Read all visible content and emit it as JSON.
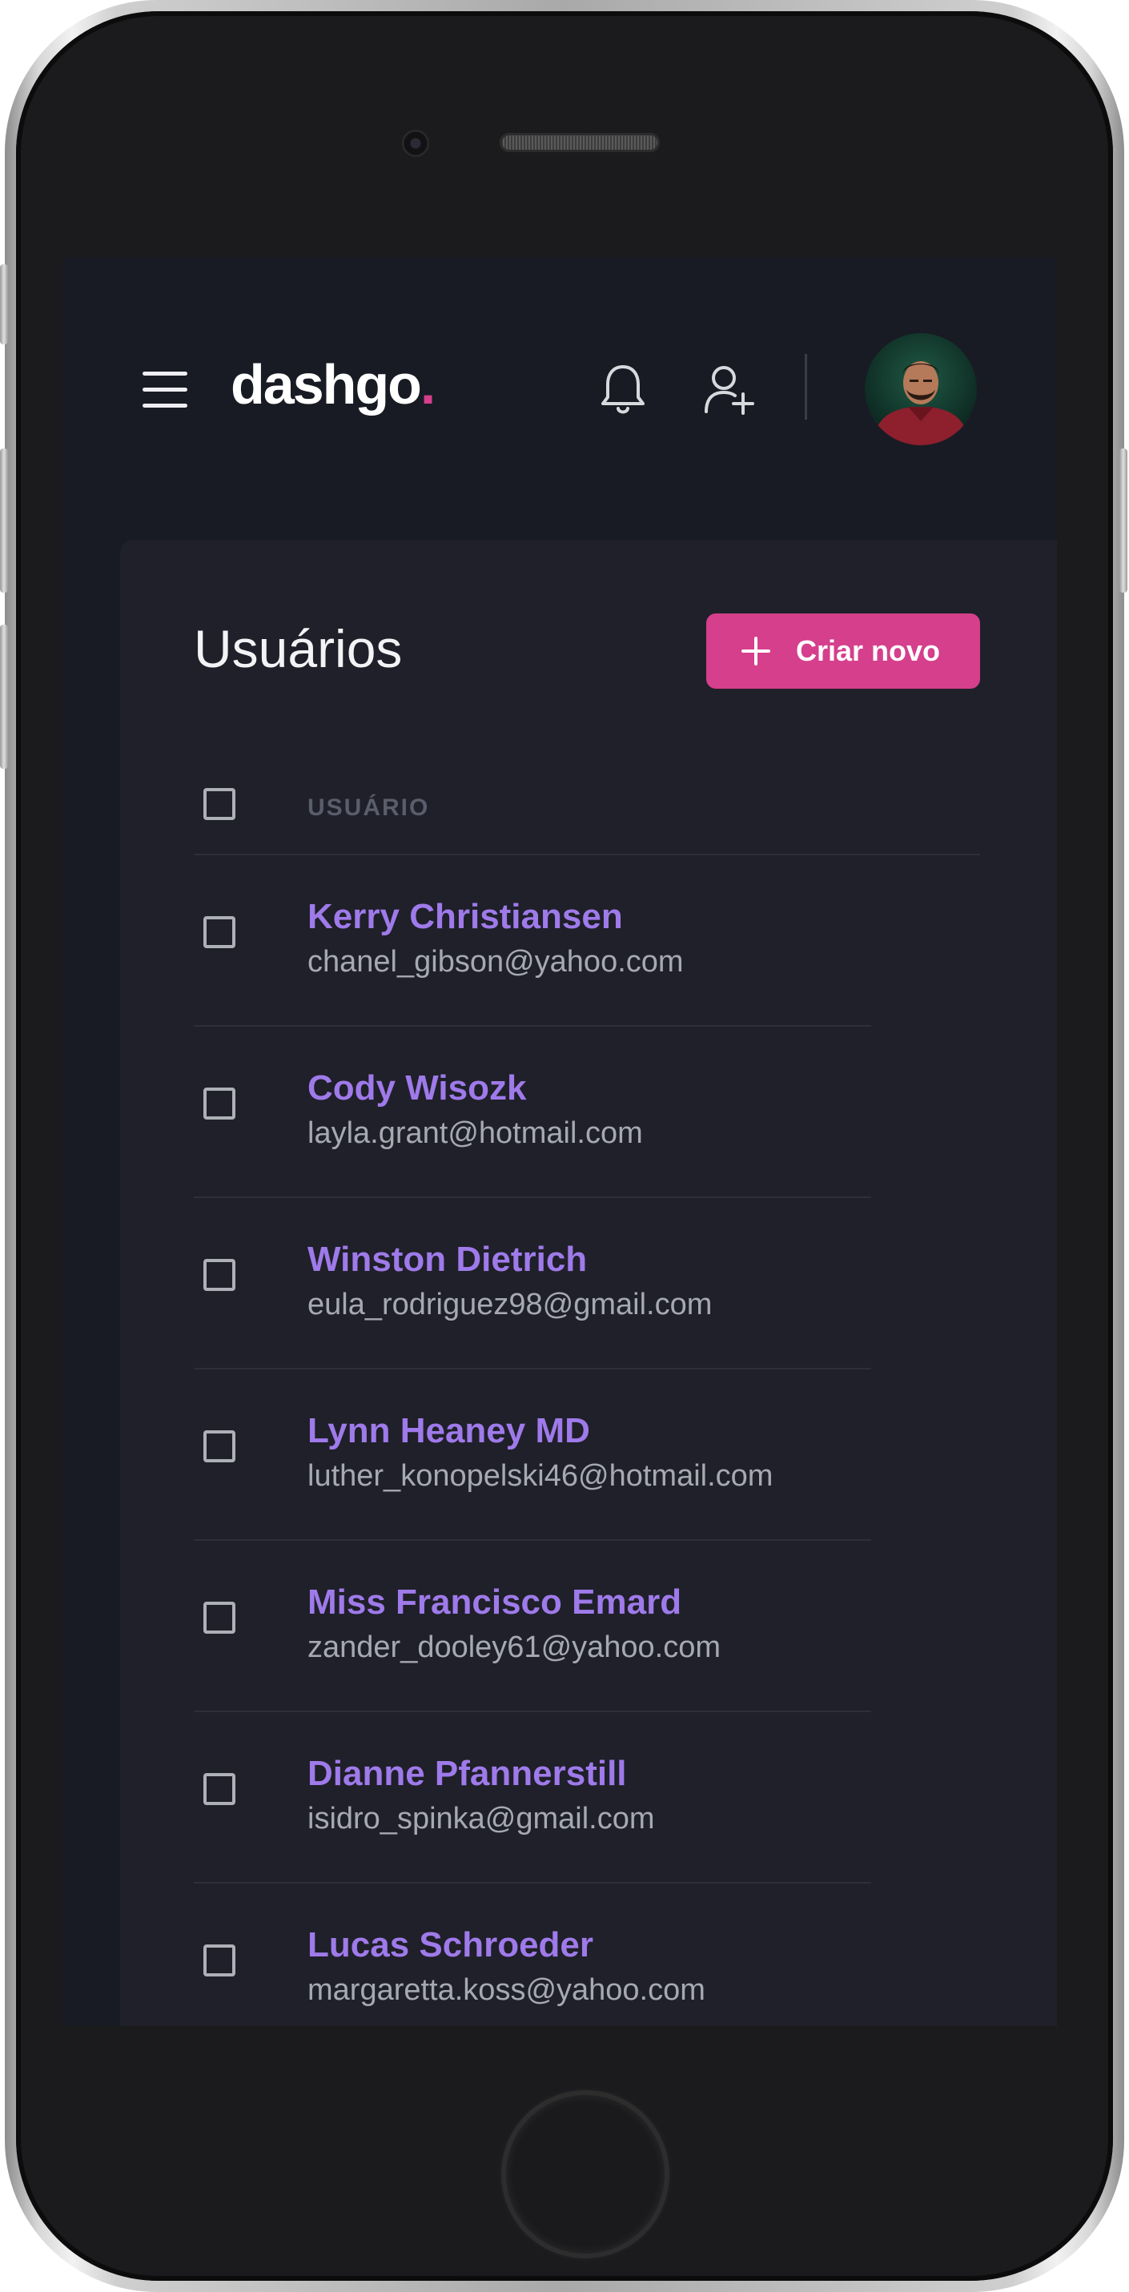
{
  "header": {
    "brand": "dashgo",
    "brand_dot": "."
  },
  "page": {
    "title": "Usuários",
    "create_button_label": "Criar novo"
  },
  "table": {
    "column_header": "USUÁRIO",
    "rows": [
      {
        "name": "Kerry Christiansen",
        "email": "chanel_gibson@yahoo.com"
      },
      {
        "name": "Cody Wisozk",
        "email": "layla.grant@hotmail.com"
      },
      {
        "name": "Winston Dietrich",
        "email": "eula_rodriguez98@gmail.com"
      },
      {
        "name": "Lynn Heaney MD",
        "email": "luther_konopelski46@hotmail.com"
      },
      {
        "name": "Miss Francisco Emard",
        "email": "zander_dooley61@yahoo.com"
      },
      {
        "name": "Dianne Pfannerstill",
        "email": "isidro_spinka@gmail.com"
      },
      {
        "name": "Lucas Schroeder",
        "email": "margaretta.koss@yahoo.com"
      }
    ]
  },
  "colors": {
    "accent": "#d53f8c",
    "name_text": "#9f7aea",
    "background": "#181b23",
    "card": "#1f2029"
  },
  "icons": [
    "menu-icon",
    "bell-icon",
    "add-user-icon",
    "avatar",
    "plus-icon",
    "checkbox"
  ]
}
